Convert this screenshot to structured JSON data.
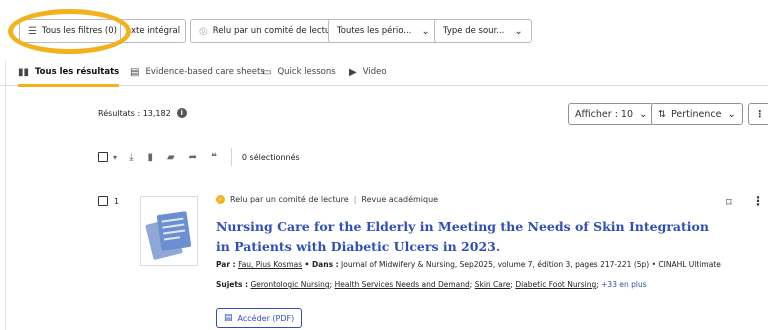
{
  "filters": {
    "all_filters_label": "Tous les filtres (0)",
    "full_text_label": "xte intégral",
    "peer_reviewed_label": "Relu par un comité de lecture",
    "all_periods_label": "Toutes les pério...",
    "source_type_label": "Type de sour..."
  },
  "tabs": [
    {
      "label": "Tous les résultats",
      "icon": "book-icon"
    },
    {
      "label": "Evidence-based care sheets",
      "icon": "document-icon"
    },
    {
      "label": "Quick lessons",
      "icon": "screen-icon"
    },
    {
      "label": "Video",
      "icon": "play-icon"
    }
  ],
  "results": {
    "count_label": "Résultats : 13,182",
    "show_label": "Afficher : 10",
    "sort_label": "Pertinence",
    "selected_label": "0 sélectionnés"
  },
  "item": {
    "number": "1",
    "peer_reviewed": "Relu par un comité de lecture",
    "journal_type": "Revue académique",
    "title": "Nursing Care for the Elderly in Meeting the Needs of Skin Integration in Patients with Diabetic Ulcers in 2023.",
    "by_prefix": "Par :",
    "author": "Fau, Pius Kosmas",
    "in_prefix": "• Dans :",
    "source": "Journal of Midwifery & Nursing, Sep2025, volume 7, édition 3, pages 217-221 (5p) • CINAHL Ultimate",
    "subjects_prefix": "Sujets :",
    "subjects": [
      "Gerontologic Nursing",
      "Health Services Needs and Demand",
      "Skin Care",
      "Diabetic Foot Nursing"
    ],
    "more_subjects": "+33 en plus",
    "access_label": "Accéder (PDF)"
  },
  "colors": {
    "accent": "#f2b21c",
    "link": "#2e4fb8"
  }
}
